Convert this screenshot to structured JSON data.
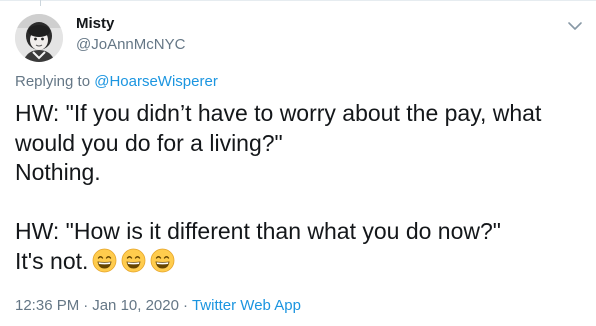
{
  "author": {
    "name": "Misty",
    "handle": "@JoAnnMcNYC"
  },
  "reply": {
    "prefix": "Replying to",
    "mention": "@HoarseWisperer"
  },
  "tweet": {
    "lines": [
      "HW: \"If you didn’t have to worry about the pay, what",
      "would you do for a living?\"",
      "Nothing.",
      "",
      "HW: \"How is it different than what you do now?\"",
      "It's not."
    ],
    "emoji": [
      "grinning-face-with-smiling-eyes",
      "grinning-face-with-smiling-eyes",
      "grinning-face-with-smiling-eyes"
    ]
  },
  "meta": {
    "time": "12:36 PM",
    "separator": "·",
    "date": "Jan 10, 2020",
    "source": "Twitter Web App"
  },
  "icons": {
    "caret": "chevron-down-icon",
    "avatar": "profile-photo"
  },
  "colors": {
    "text": "#14171a",
    "secondary": "#657786",
    "link": "#1b95e0",
    "emoji_face": "#ffcc4d"
  }
}
